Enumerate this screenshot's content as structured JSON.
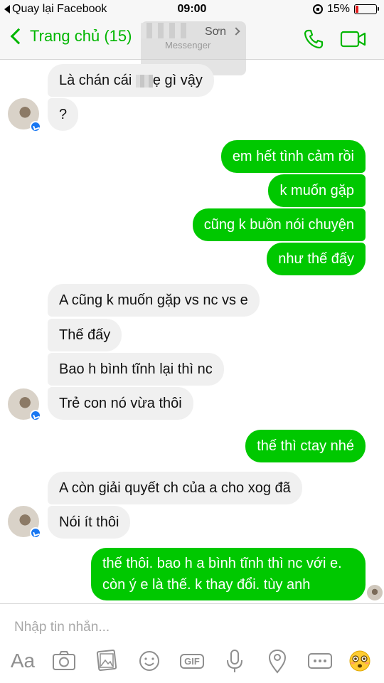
{
  "status_bar": {
    "back_app": "Quay lại Facebook",
    "time": "09:00",
    "battery": "15%",
    "battery_level": 0.15
  },
  "header": {
    "back_label": "Trang chủ (15)",
    "contact_name": "Sơn",
    "contact_sub": "Messenger",
    "accent": "#00b600"
  },
  "messages": [
    {
      "side": "in",
      "text_pre": "Là chán cái",
      "text_post": "ẹ gì vậy"
    },
    {
      "side": "in",
      "text": "?"
    },
    {
      "side": "out",
      "text": "em hết tình cảm rồi"
    },
    {
      "side": "out",
      "text": "k muốn gặp"
    },
    {
      "side": "out",
      "text": "cũng k buồn nói chuyện"
    },
    {
      "side": "out",
      "text": "như thế đấy"
    },
    {
      "side": "in",
      "text": "A cũng k muốn gặp vs nc vs e"
    },
    {
      "side": "in",
      "text": "Thế đấy"
    },
    {
      "side": "in",
      "text": "Bao h bình tĩnh lại thì nc"
    },
    {
      "side": "in",
      "text": "Trẻ con nó vừa thôi"
    },
    {
      "side": "out",
      "text": "thế thì ctay nhé"
    },
    {
      "side": "in",
      "text": "A còn giải quyết ch của a cho xog đã"
    },
    {
      "side": "in",
      "text": "Nói ít thôi"
    },
    {
      "side": "out",
      "line1": "thế thôi. bao h a bình tĩnh thì nc với e.",
      "line2": "còn ý e là thế. k thay đổi. tùy anh"
    }
  ],
  "composer": {
    "placeholder": "Nhập tin nhắn...",
    "aa_label": "Aa",
    "gif_label": "GIF"
  },
  "toolbar_icons": [
    "text-format-icon",
    "camera-icon",
    "photo-icon",
    "sticker-icon",
    "gif-icon",
    "microphone-icon",
    "location-icon",
    "more-icon",
    "emoji-icon"
  ],
  "colors": {
    "outgoing_bubble": "#00c800",
    "incoming_bubble": "#f0f0f0",
    "brand_green": "#00b600"
  }
}
